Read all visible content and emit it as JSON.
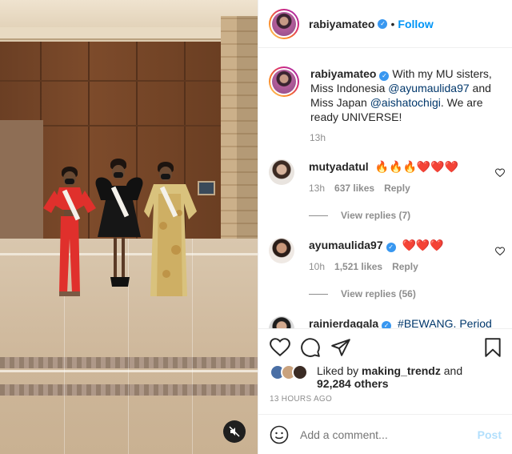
{
  "header": {
    "username": "rabiyamateo",
    "separator": "•",
    "follow_label": "Follow"
  },
  "caption": {
    "username": "rabiyamateo",
    "text_before": "With my MU sisters, Miss Indonesia ",
    "mention1": "@ayumaulida97",
    "text_mid": " and Miss Japan ",
    "mention2": "@aishatochigi",
    "text_after": ". We are ready UNIVERSE!",
    "time": "13h"
  },
  "comments": [
    {
      "username": "mutyadatul",
      "text": "🔥🔥🔥❤️❤️❤️",
      "time": "13h",
      "likes": "637 likes",
      "reply_label": "Reply",
      "view_replies": "View replies (7)"
    },
    {
      "username": "ayumaulida97",
      "text": "❤️❤️❤️",
      "time": "10h",
      "likes": "1,521 likes",
      "reply_label": "Reply",
      "view_replies": "View replies (56)"
    },
    {
      "username": "rainierdagala",
      "text": "#BEWANG. Period"
    }
  ],
  "actions": {
    "liked_prefix": "Liked by ",
    "liked_user": "making_trendz",
    "liked_middle": " and",
    "liked_count": "92,284 others",
    "time_ago": "13 HOURS AGO"
  },
  "add_comment": {
    "placeholder": "Add a comment...",
    "post_label": "Post"
  },
  "icons": {
    "verified": "verified-badge-icon",
    "heart": "heart-icon",
    "comment": "comment-icon",
    "share": "share-icon",
    "save": "bookmark-icon",
    "emoji": "emoji-icon",
    "mute": "mute-icon"
  },
  "colors": {
    "link_blue": "#0095f6",
    "mention_blue": "#00376b",
    "verified_blue": "#3897f0",
    "muted_text": "#8e8e8e",
    "post_disabled": "#b2dffc"
  }
}
